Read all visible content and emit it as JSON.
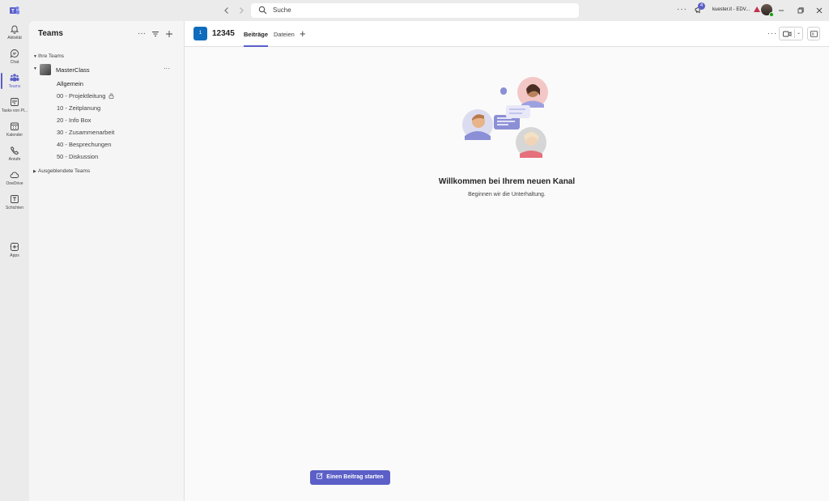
{
  "titlebar": {
    "search_placeholder": "Suche",
    "more": "···",
    "activity_badge": "4",
    "tenant": "kuester.it - EDV...",
    "back_icon": "chevron-left-icon",
    "forward_icon": "chevron-right-icon"
  },
  "rail": {
    "items": [
      {
        "label": "Aktivität",
        "icon": "bell-icon"
      },
      {
        "label": "Chat",
        "icon": "chat-icon"
      },
      {
        "label": "Teams",
        "icon": "teams-icon"
      },
      {
        "label": "Tasks von Pl...",
        "icon": "tasks-icon"
      },
      {
        "label": "Kalender",
        "icon": "calendar-icon"
      },
      {
        "label": "Anrufe",
        "icon": "phone-icon"
      },
      {
        "label": "OneDrive",
        "icon": "cloud-icon"
      },
      {
        "label": "Schichten",
        "icon": "shifts-icon"
      },
      {
        "label": "Apps",
        "icon": "plus-square-icon"
      }
    ],
    "more": "···",
    "active_color": "#5b5fc7"
  },
  "teams_pane": {
    "title": "Teams",
    "more": "···",
    "add": "+",
    "your_teams": "Ihre Teams",
    "team_name": "MasterClass",
    "team_more": "···",
    "channels": [
      "Allgemein",
      "00 - Projektleitung",
      "10 - Zeitplanung",
      "20 - Info Box",
      "30 - Zusammenarbeit",
      "40 - Besprechungen",
      "50 - Diskussion"
    ],
    "hidden_teams": "Ausgeblendete Teams"
  },
  "main": {
    "channel_tile": "1",
    "channel_title": "12345",
    "tabs": [
      "Beiträge",
      "Dateien"
    ],
    "tab_add": "+",
    "more": "···",
    "welcome_title": "Willkommen bei Ihrem neuen Kanal",
    "welcome_sub": "Beginnen wir die Unterhaltung.",
    "start_post": "Einen Beitrag starten",
    "accent_color": "#5b5fc7"
  }
}
